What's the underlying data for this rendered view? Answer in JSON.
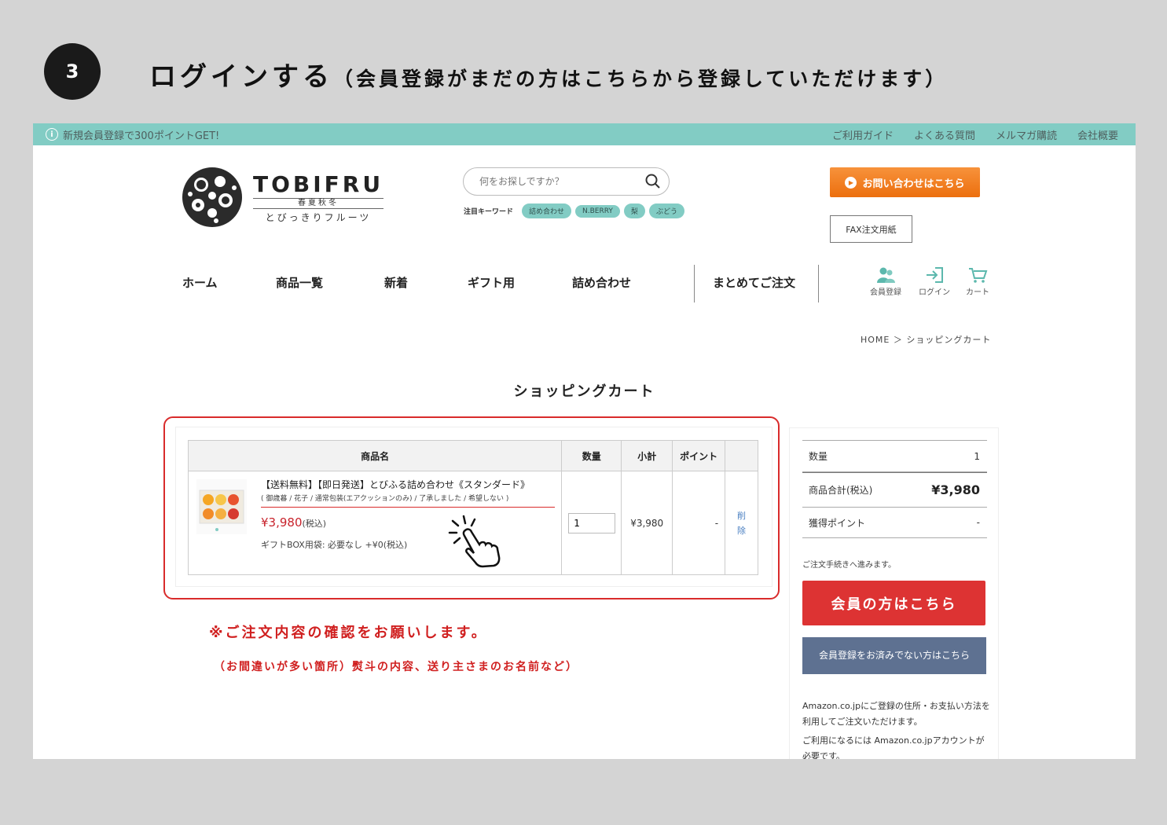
{
  "step": {
    "number": "3",
    "title": "ログインする",
    "subtitle": "（会員登録がまだの方はこちらから登録していただけます）"
  },
  "topbar": {
    "notice": "新規会員登録で300ポイントGET!",
    "links": [
      "ご利用ガイド",
      "よくある質問",
      "メルマガ購読",
      "会社概要"
    ]
  },
  "logo": {
    "en": "TOBIFRU",
    "season": "春夏秋冬",
    "jp": "とびっきりフルーツ"
  },
  "search": {
    "placeholder": "何をお探しですか？",
    "keyword_label": "注目キーワード",
    "keywords": [
      "詰め合わせ",
      "N.BERRY",
      "梨",
      "ぶどう"
    ]
  },
  "header": {
    "contact_label": "お問い合わせはこちら",
    "fax_label": "FAX注文用紙"
  },
  "nav": {
    "items": [
      "ホーム",
      "商品一覧",
      "新着",
      "ギフト用",
      "詰め合わせ",
      "まとめてご注文"
    ],
    "icons": [
      {
        "label": "会員登録",
        "icon": "member-icon"
      },
      {
        "label": "ログイン",
        "icon": "login-icon"
      },
      {
        "label": "カート",
        "icon": "cart-icon"
      }
    ]
  },
  "breadcrumb": "HOME ＞ ショッピングカート",
  "page_title": "ショッピングカート",
  "cart": {
    "headers": [
      "商品名",
      "数量",
      "小計",
      "ポイント"
    ],
    "item": {
      "name": "【送料無料】【即日発送】とびふる詰め合わせ《スタンダード》",
      "options": "( 御歳暮 / 花子 / 通常包装(エアクッションのみ) / 了承しました / 希望しない )",
      "price": "¥3,980",
      "price_tax": "(税込)",
      "box": "ギフトBOX用袋: 必要なし +¥0(税込)",
      "quantity": "1",
      "subtotal": "¥3,980",
      "points": "-",
      "delete_label": "削除"
    }
  },
  "notes": {
    "line1": "※ご注文内容の確認をお願いします。",
    "line2": "（お間違いが多い箇所）熨斗の内容、送り主さまのお名前など）"
  },
  "summary": {
    "qty_label": "数量",
    "qty_value": "1",
    "total_label": "商品合計(税込)",
    "total_value": "¥3,980",
    "points_label": "獲得ポイント",
    "points_value": "-",
    "proceed_note": "ご注文手続きへ進みます。",
    "member_button": "会員の方はこちら",
    "guest_button": "会員登録をお済みでない方はこちら",
    "amazon_line1": "Amazon.co.jpにご登録の住所・お支払い方法を利用してご注文いただけます。",
    "amazon_line2": "ご利用になるには Amazon.co.jpアカウントが必要です。"
  },
  "colors": {
    "topbar": "#82ccc4",
    "accent_red": "#dd3333",
    "contact_orange": "#ee7a19",
    "guest_button": "#5e7191"
  }
}
